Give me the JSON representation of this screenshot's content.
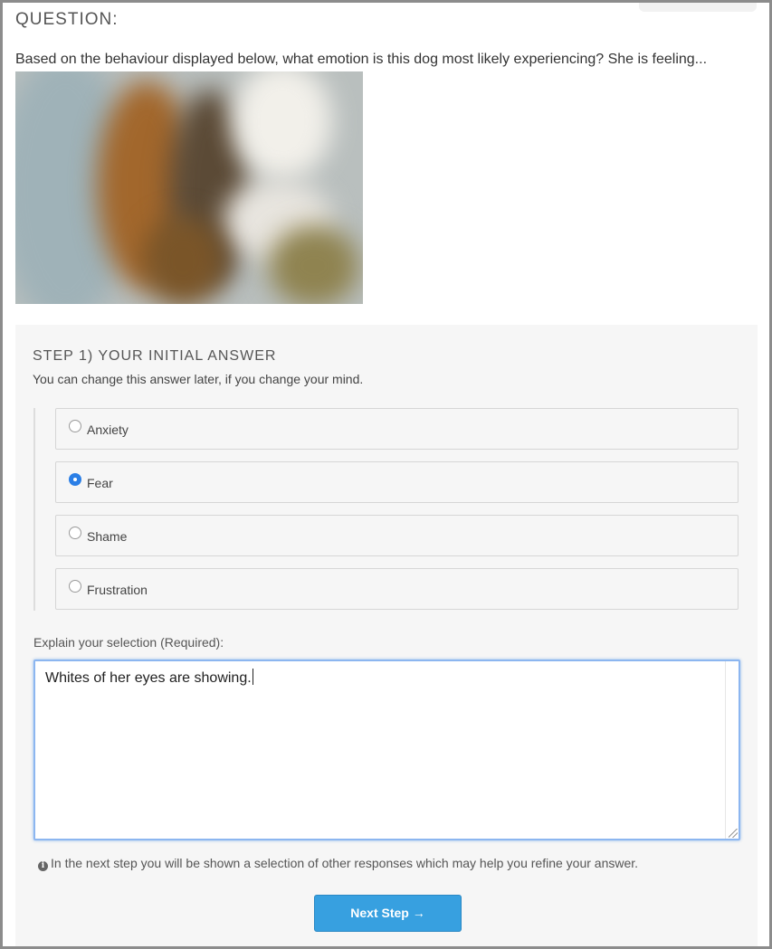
{
  "question": {
    "heading": "QUESTION:",
    "text": "Based on the behaviour displayed below, what emotion is this dog most likely experiencing? She is feeling..."
  },
  "step": {
    "title": "STEP 1) YOUR INITIAL ANSWER",
    "subtitle": "You can change this answer later, if you change your mind.",
    "options": [
      {
        "label": "Anxiety",
        "selected": false
      },
      {
        "label": "Fear",
        "selected": true
      },
      {
        "label": "Shame",
        "selected": false
      },
      {
        "label": "Frustration",
        "selected": false
      }
    ],
    "explain_label": "Explain your selection (Required):",
    "explain_value": "Whites of her eyes are showing.",
    "info_icon": "info-circle-icon",
    "info_text": "In the next step you will be shown a selection of other responses which may help you refine your answer.",
    "next_label": "Next Step →"
  },
  "colors": {
    "accent": "#37a0e0",
    "radio_selected": "#2b7fe6",
    "panel_bg": "#f6f6f6"
  }
}
